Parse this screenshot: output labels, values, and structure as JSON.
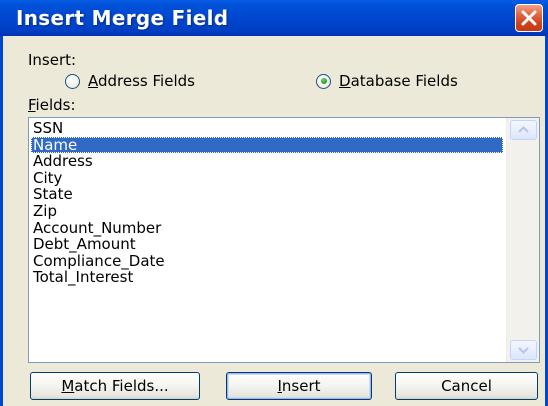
{
  "dialog": {
    "title": "Insert Merge Field",
    "close_icon": "close-icon",
    "insert_label": "Insert:",
    "radios": [
      {
        "label_key": "A",
        "label_rest": "ddress Fields",
        "selected": false
      },
      {
        "label_key": "D",
        "label_rest": "atabase Fields",
        "selected": true
      }
    ],
    "fields_label_key": "F",
    "fields_label_rest": "ields:",
    "fields": [
      "SSN",
      "Name",
      "Address",
      "City",
      "State",
      "Zip",
      "Account_Number",
      "Debt_Amount",
      "Compliance_Date",
      "Total_Interest"
    ],
    "selected_field": "Name",
    "buttons": {
      "match_key": "M",
      "match_rest": "atch Fields...",
      "insert_key": "I",
      "insert_rest": "nsert",
      "cancel": "Cancel"
    },
    "colors": {
      "title_bar": "#0047cf",
      "selection": "#316ac5",
      "close_button": "#d1431e"
    }
  }
}
